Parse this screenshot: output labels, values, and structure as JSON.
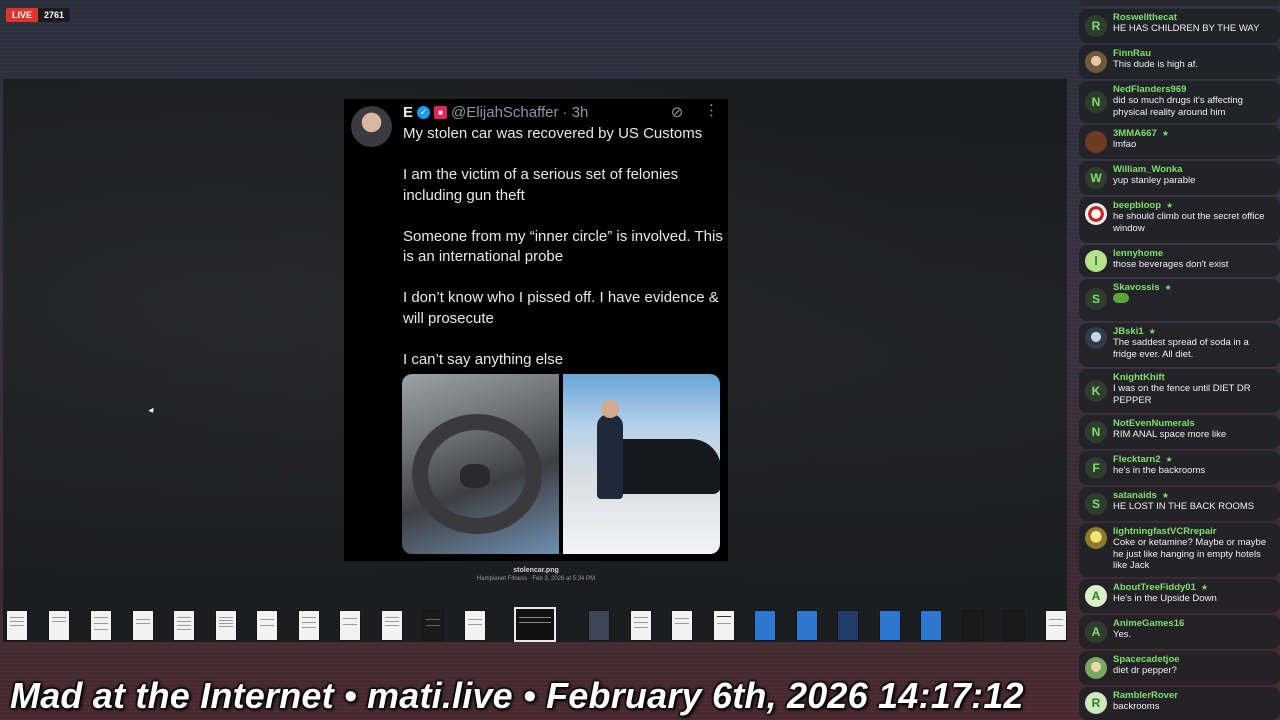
{
  "stream": {
    "live_label": "LIVE",
    "viewers": "2761"
  },
  "tweet": {
    "name": "E",
    "handle": "@ElijahSchaffer",
    "time": "· 3h",
    "paragraphs": [
      "My stolen car was recovered by US Customs",
      "I am the victim of a serious set of felonies including gun theft",
      "Someone from my “inner circle” is involved. This is an international probe",
      "I don’t know who I pissed off. I have evidence & will prosecute",
      "I can’t say anything else"
    ]
  },
  "file": {
    "name": "stolencar.png",
    "meta": "Hampianet Fitness · Feb 3, 2026 at 5:34 PM"
  },
  "title_bar": {
    "text": "Mad at the Internet • mati.live • February 6th, 2026 14:17:12"
  },
  "chat": [
    {
      "user": "Roswellthecat",
      "text": "HE HAS CHILDREN BY THE WAY",
      "avatar": "R",
      "star": false
    },
    {
      "user": "FinnRau",
      "text": "This dude is high af.",
      "avatar": "",
      "star": false
    },
    {
      "user": "NedFlanders969",
      "text": "did so much drugs it's affecting physical reality around him",
      "avatar": "N",
      "star": false
    },
    {
      "user": "3MMA667",
      "text": "lmfao",
      "avatar": "",
      "star": true
    },
    {
      "user": "William_Wonka",
      "text": "yup stanley parable",
      "avatar": "W",
      "star": false
    },
    {
      "user": "beepbloop",
      "text": "he should climb out the secret office window",
      "avatar": "",
      "star": true
    },
    {
      "user": "lennyhome",
      "text": "those beverages don't exist",
      "avatar": "l",
      "star": false
    },
    {
      "user": "Skavossis",
      "text": "",
      "avatar": "S",
      "star": true
    },
    {
      "user": "JBski1",
      "text": "The saddest spread of soda in a fridge ever. All diet.",
      "avatar": "",
      "star": true
    },
    {
      "user": "KnightKhift",
      "text": "I was on the fence until DIET DR PEPPER",
      "avatar": "K",
      "star": false
    },
    {
      "user": "NotEvenNumerals",
      "text": "RIM ANAL space more like",
      "avatar": "N",
      "star": false
    },
    {
      "user": "Flecktarn2",
      "text": "he's in the backrooms",
      "avatar": "F",
      "star": true
    },
    {
      "user": "satanaids",
      "text": "HE LOST IN THE BACK ROOMS",
      "avatar": "S",
      "star": true
    },
    {
      "user": "lightningfastVCRrepair",
      "text": "Coke or ketamine? Maybe or maybe he just like hanging in empty hotels like Jack",
      "avatar": "",
      "star": false
    },
    {
      "user": "AboutTreeFiddy01",
      "text": "He's in the Upside Down",
      "avatar": "A",
      "star": true
    },
    {
      "user": "AnimeGames16",
      "text": "Yes.",
      "avatar": "A",
      "star": false
    },
    {
      "user": "Spacecadetjoe",
      "text": "diet dr pepper?",
      "avatar": "",
      "star": false
    },
    {
      "user": "RamblerRover",
      "text": "backrooms",
      "avatar": "R",
      "star": false
    }
  ]
}
